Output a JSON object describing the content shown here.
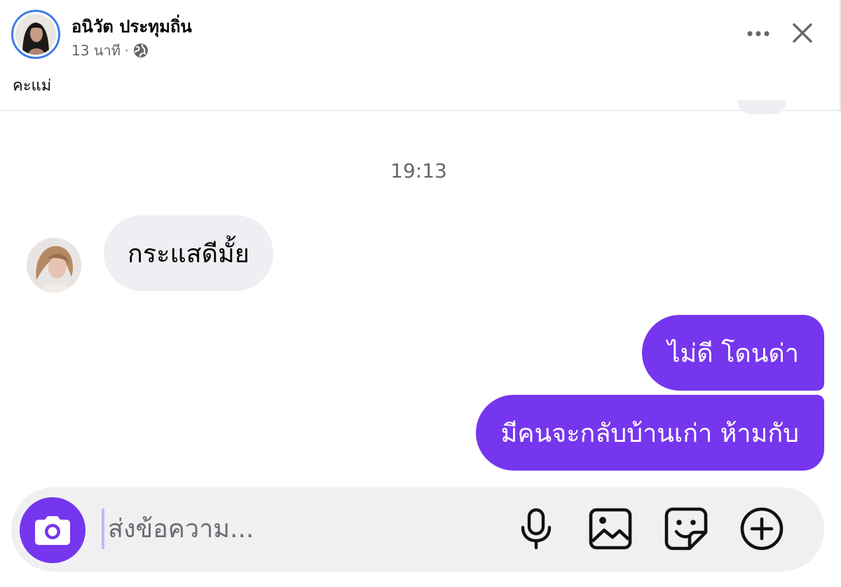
{
  "post": {
    "author_name": "อนิวัต ประทุมถิ่น",
    "time_ago": "13 นาที",
    "separator": "·",
    "caption": "คะแม่"
  },
  "chat": {
    "timestamp": "19:13",
    "messages": [
      {
        "side": "incoming",
        "text": "กระแสดีมั้ย"
      },
      {
        "side": "outgoing",
        "text": "ไม่ดี โดนด่า"
      },
      {
        "side": "outgoing",
        "text": "มีคนจะกลับบ้านเก่า ห้ามกับ"
      }
    ]
  },
  "composer": {
    "placeholder": "ส่งข้อความ..."
  },
  "colors": {
    "accent": "#7636ee",
    "bubble_incoming": "#eeeff2",
    "avatar_ring": "#3f7ce8",
    "muted_text": "#65676b"
  },
  "icons": {
    "more": "more-horizontal-icon",
    "close": "close-icon",
    "globe": "globe-icon",
    "camera": "camera-icon",
    "mic": "microphone-icon",
    "image": "image-icon",
    "sticker": "sticker-icon",
    "plus": "plus-circle-icon"
  }
}
